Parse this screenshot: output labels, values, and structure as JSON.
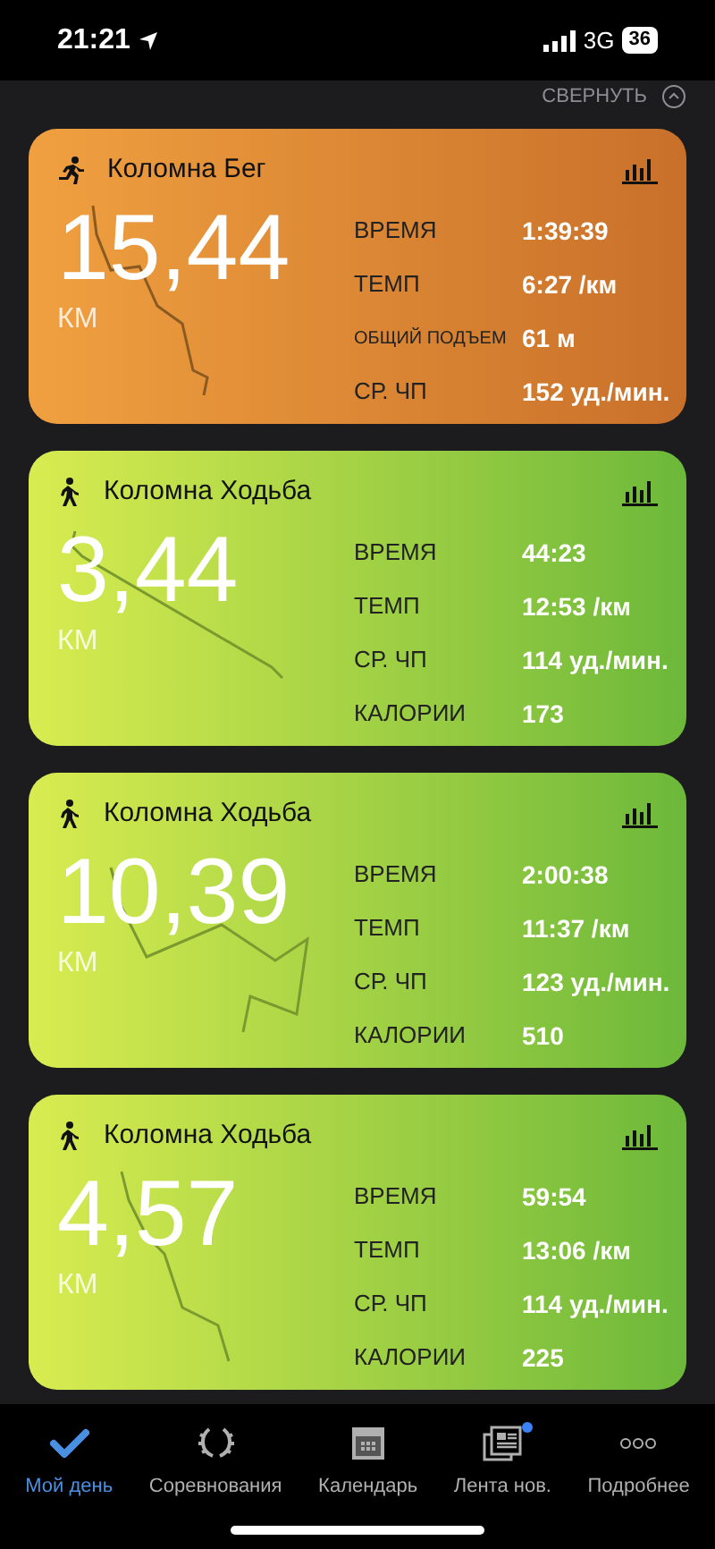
{
  "status_bar": {
    "time": "21:21",
    "network": "3G",
    "battery": "36"
  },
  "collapse_label": "СВЕРНУТЬ",
  "activities": [
    {
      "kind": "run",
      "title": "Коломна Бег",
      "distance": "15,44",
      "unit": "КМ",
      "stats": [
        {
          "label": "ВРЕМЯ",
          "value": "1:39:39"
        },
        {
          "label": "ТЕМП",
          "value": "6:27 /км"
        },
        {
          "label": "ОБЩИЙ ПОДЪЕМ",
          "value": "61 м"
        },
        {
          "label": "СР. ЧП",
          "value": "152 уд./мин."
        }
      ]
    },
    {
      "kind": "walk",
      "title": "Коломна Ходьба",
      "distance": "3,44",
      "unit": "КМ",
      "stats": [
        {
          "label": "ВРЕМЯ",
          "value": "44:23"
        },
        {
          "label": "ТЕМП",
          "value": "12:53 /км"
        },
        {
          "label": "СР. ЧП",
          "value": "114 уд./мин."
        },
        {
          "label": "КАЛОРИИ",
          "value": "173"
        }
      ]
    },
    {
      "kind": "walk",
      "title": "Коломна Ходьба",
      "distance": "10,39",
      "unit": "КМ",
      "stats": [
        {
          "label": "ВРЕМЯ",
          "value": "2:00:38"
        },
        {
          "label": "ТЕМП",
          "value": "11:37 /км"
        },
        {
          "label": "СР. ЧП",
          "value": "123 уд./мин."
        },
        {
          "label": "КАЛОРИИ",
          "value": "510"
        }
      ]
    },
    {
      "kind": "walk",
      "title": "Коломна Ходьба",
      "distance": "4,57",
      "unit": "КМ",
      "stats": [
        {
          "label": "ВРЕМЯ",
          "value": "59:54"
        },
        {
          "label": "ТЕМП",
          "value": "13:06 /км"
        },
        {
          "label": "СР. ЧП",
          "value": "114 уд./мин."
        },
        {
          "label": "КАЛОРИИ",
          "value": "225"
        }
      ]
    }
  ],
  "tab_bar": [
    {
      "kind": "check",
      "label": "Мой день",
      "selected": true,
      "badge": false
    },
    {
      "kind": "laurel",
      "label": "Соревнования",
      "selected": false,
      "badge": false
    },
    {
      "kind": "calendar",
      "label": "Календарь",
      "selected": false,
      "badge": false
    },
    {
      "kind": "news",
      "label": "Лента нов.",
      "selected": false,
      "badge": true
    },
    {
      "kind": "more",
      "label": "Подробнее",
      "selected": false,
      "badge": false
    }
  ]
}
